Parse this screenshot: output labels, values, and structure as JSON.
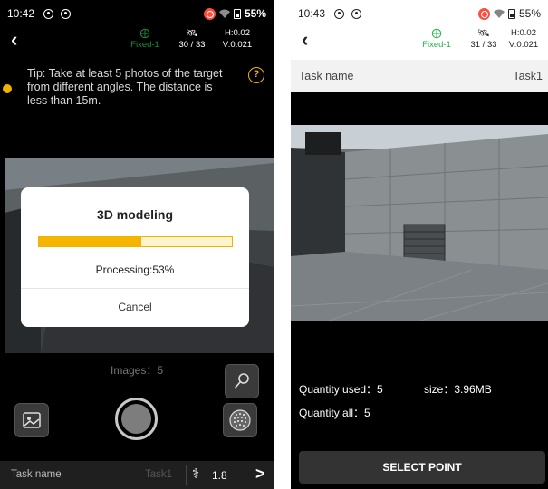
{
  "left_screen": {
    "status": {
      "time": "10:42",
      "battery": "55%"
    },
    "gnss": {
      "fix_label": "Fixed-1",
      "sats": "30 / 33",
      "h": "H:0.02",
      "v": "V:0.021"
    },
    "tip": "Tip: Take at least 5 photos of the target from different angles. The distance is less than 15m.",
    "help_glyph": "?",
    "dialog": {
      "title": "3D modeling",
      "progress_percent": 53,
      "processing_text": "Processing:53%",
      "cancel_label": "Cancel"
    },
    "images_text": "Images：5",
    "bottom_bar": {
      "task_label": "Task name",
      "task_value": "Task1",
      "pole_height": "1.8",
      "chevron": ">"
    }
  },
  "right_screen": {
    "status": {
      "time": "10:43",
      "battery": "55%"
    },
    "gnss": {
      "fix_label": "Fixed-1",
      "sats": "31 / 33",
      "h": "H:0.02",
      "v": "V:0.021"
    },
    "task_row": {
      "label": "Task name",
      "value": "Task1"
    },
    "quantity_used": "Quantity used：5",
    "size": "size：3.96MB",
    "quantity_all": "Quantity all：5",
    "select_button": "SELECT POINT"
  },
  "colors": {
    "accent_yellow": "#f5b400",
    "fix_green": "#22b14c",
    "record_red": "#ff4d3d"
  },
  "icons": [
    "back-arrow-icon",
    "gnss-fix-icon",
    "satellite-icon",
    "record-icon",
    "wifi-icon",
    "battery-icon",
    "help-icon",
    "gallery-icon",
    "shutter-icon",
    "point-cloud-icon",
    "pin-icon",
    "survey-pole-icon"
  ]
}
